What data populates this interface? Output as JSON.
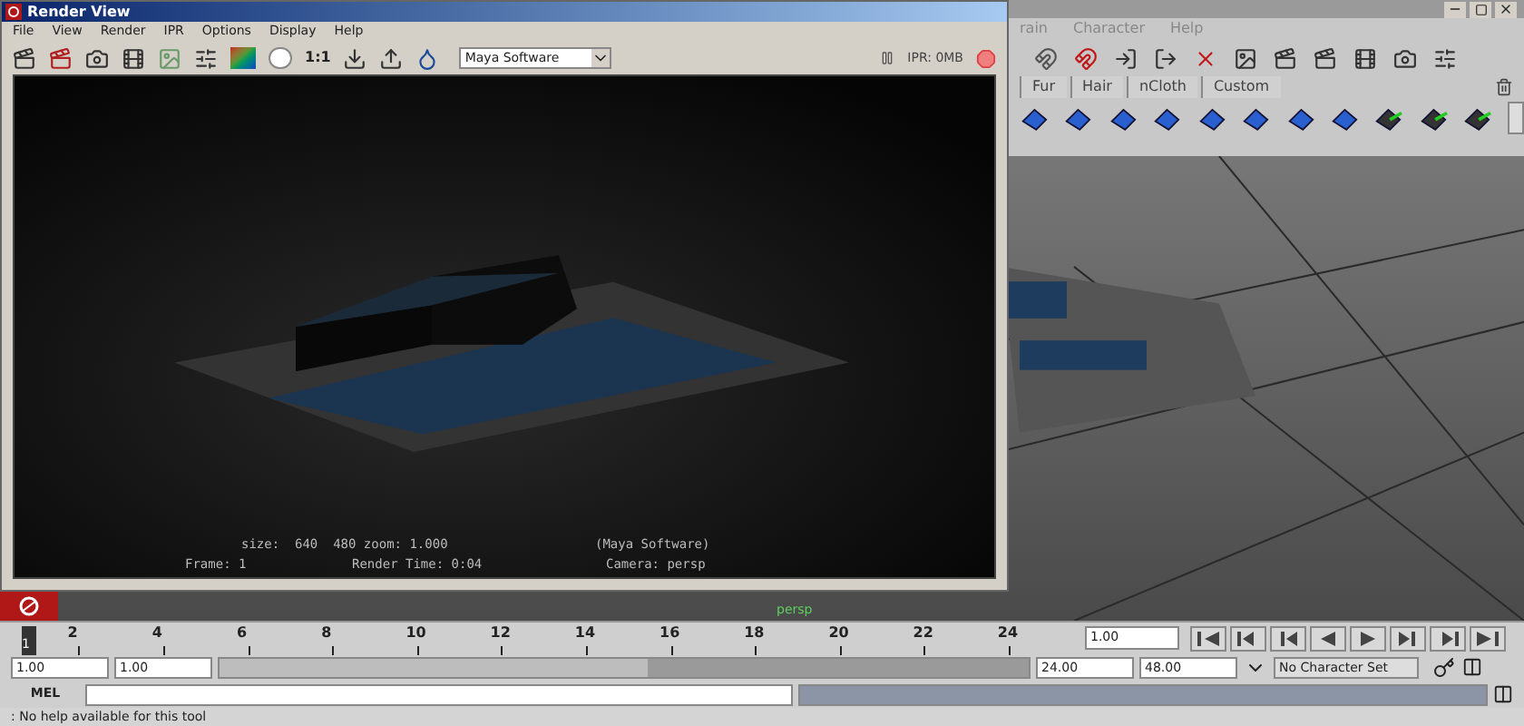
{
  "render_view": {
    "title": "Render View",
    "menu": [
      "File",
      "View",
      "Render",
      "IPR",
      "Options",
      "Display",
      "Help"
    ],
    "ratio_label": "1:1",
    "renderer": "Maya Software",
    "ipr_status": "IPR: 0MB",
    "info": {
      "size": "size:  640  480 zoom: 1.000",
      "renderer": "(Maya Software)",
      "frame": "Frame: 1",
      "render_time": "Render Time: 0:04",
      "camera": "Camera: persp"
    }
  },
  "main": {
    "menu": [
      "rain",
      "Character",
      "Help"
    ],
    "shelf_tabs": [
      "Fur",
      "Hair",
      "nCloth",
      "Custom"
    ],
    "viewport_camera": "persp"
  },
  "time_slider": {
    "level": 0,
    "current_frame": "1",
    "ticks": [
      "2",
      "4",
      "6",
      "8",
      "10",
      "12",
      "14",
      "16",
      "18",
      "20",
      "22",
      "24"
    ],
    "current_time": "1.00"
  },
  "range": {
    "level": 0.53,
    "start": "1.00",
    "range_start": "1.00",
    "range_end": "24.00",
    "end": "48.00",
    "character_set": "No Character Set"
  },
  "command_line": {
    "label": "MEL"
  },
  "help_line": ": No help available for this tool"
}
